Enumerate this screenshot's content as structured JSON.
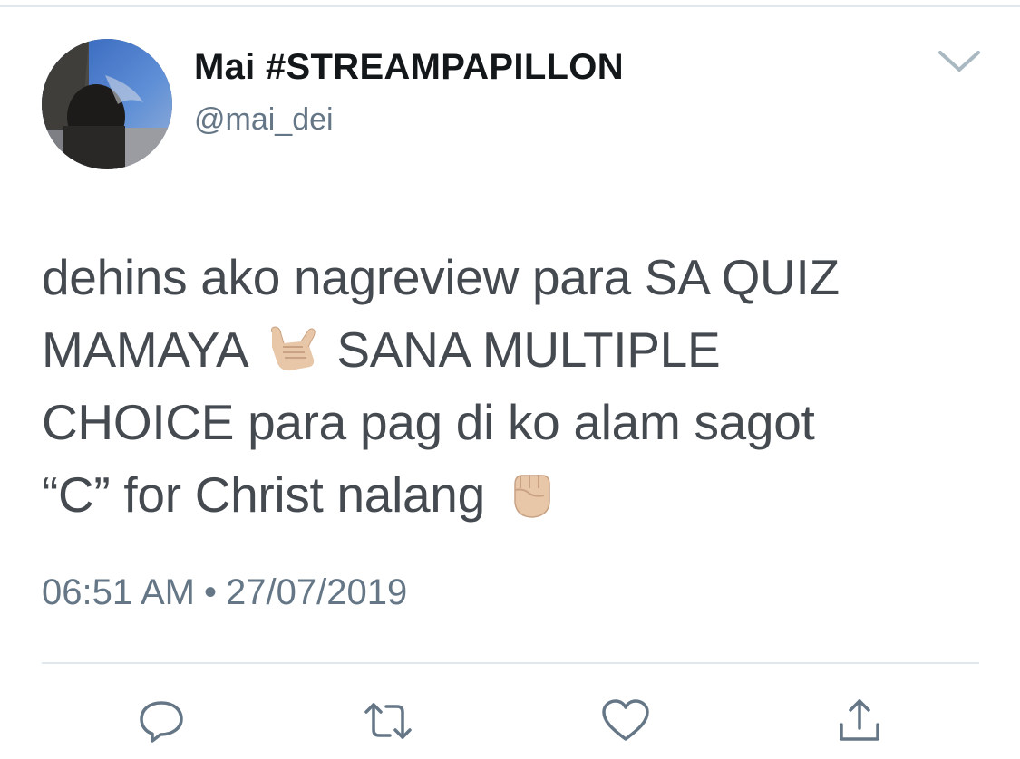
{
  "tweet": {
    "display_name": "Mai #STREAMPAPILLON",
    "handle": "@mai_dei",
    "text_line1": "dehins ako nagreview para SA QUIZ",
    "text_line2_a": "MAMAYA",
    "text_line2_b": "SANA MULTIPLE",
    "text_line3": "CHOICE para pag di ko alam sagot",
    "text_line4": "“C” for Christ nalang",
    "time": "06:51 AM",
    "separator": "•",
    "date": "27/07/2019"
  },
  "emojis": [
    "call-me-hand-emoji",
    "raised-fist-emoji"
  ],
  "actions": [
    "reply-icon",
    "retweet-icon",
    "like-icon",
    "share-icon"
  ],
  "colors": {
    "name": "#14171a",
    "secondary": "#657786",
    "body_text": "#444a50",
    "divider": "#e1e8ed"
  }
}
